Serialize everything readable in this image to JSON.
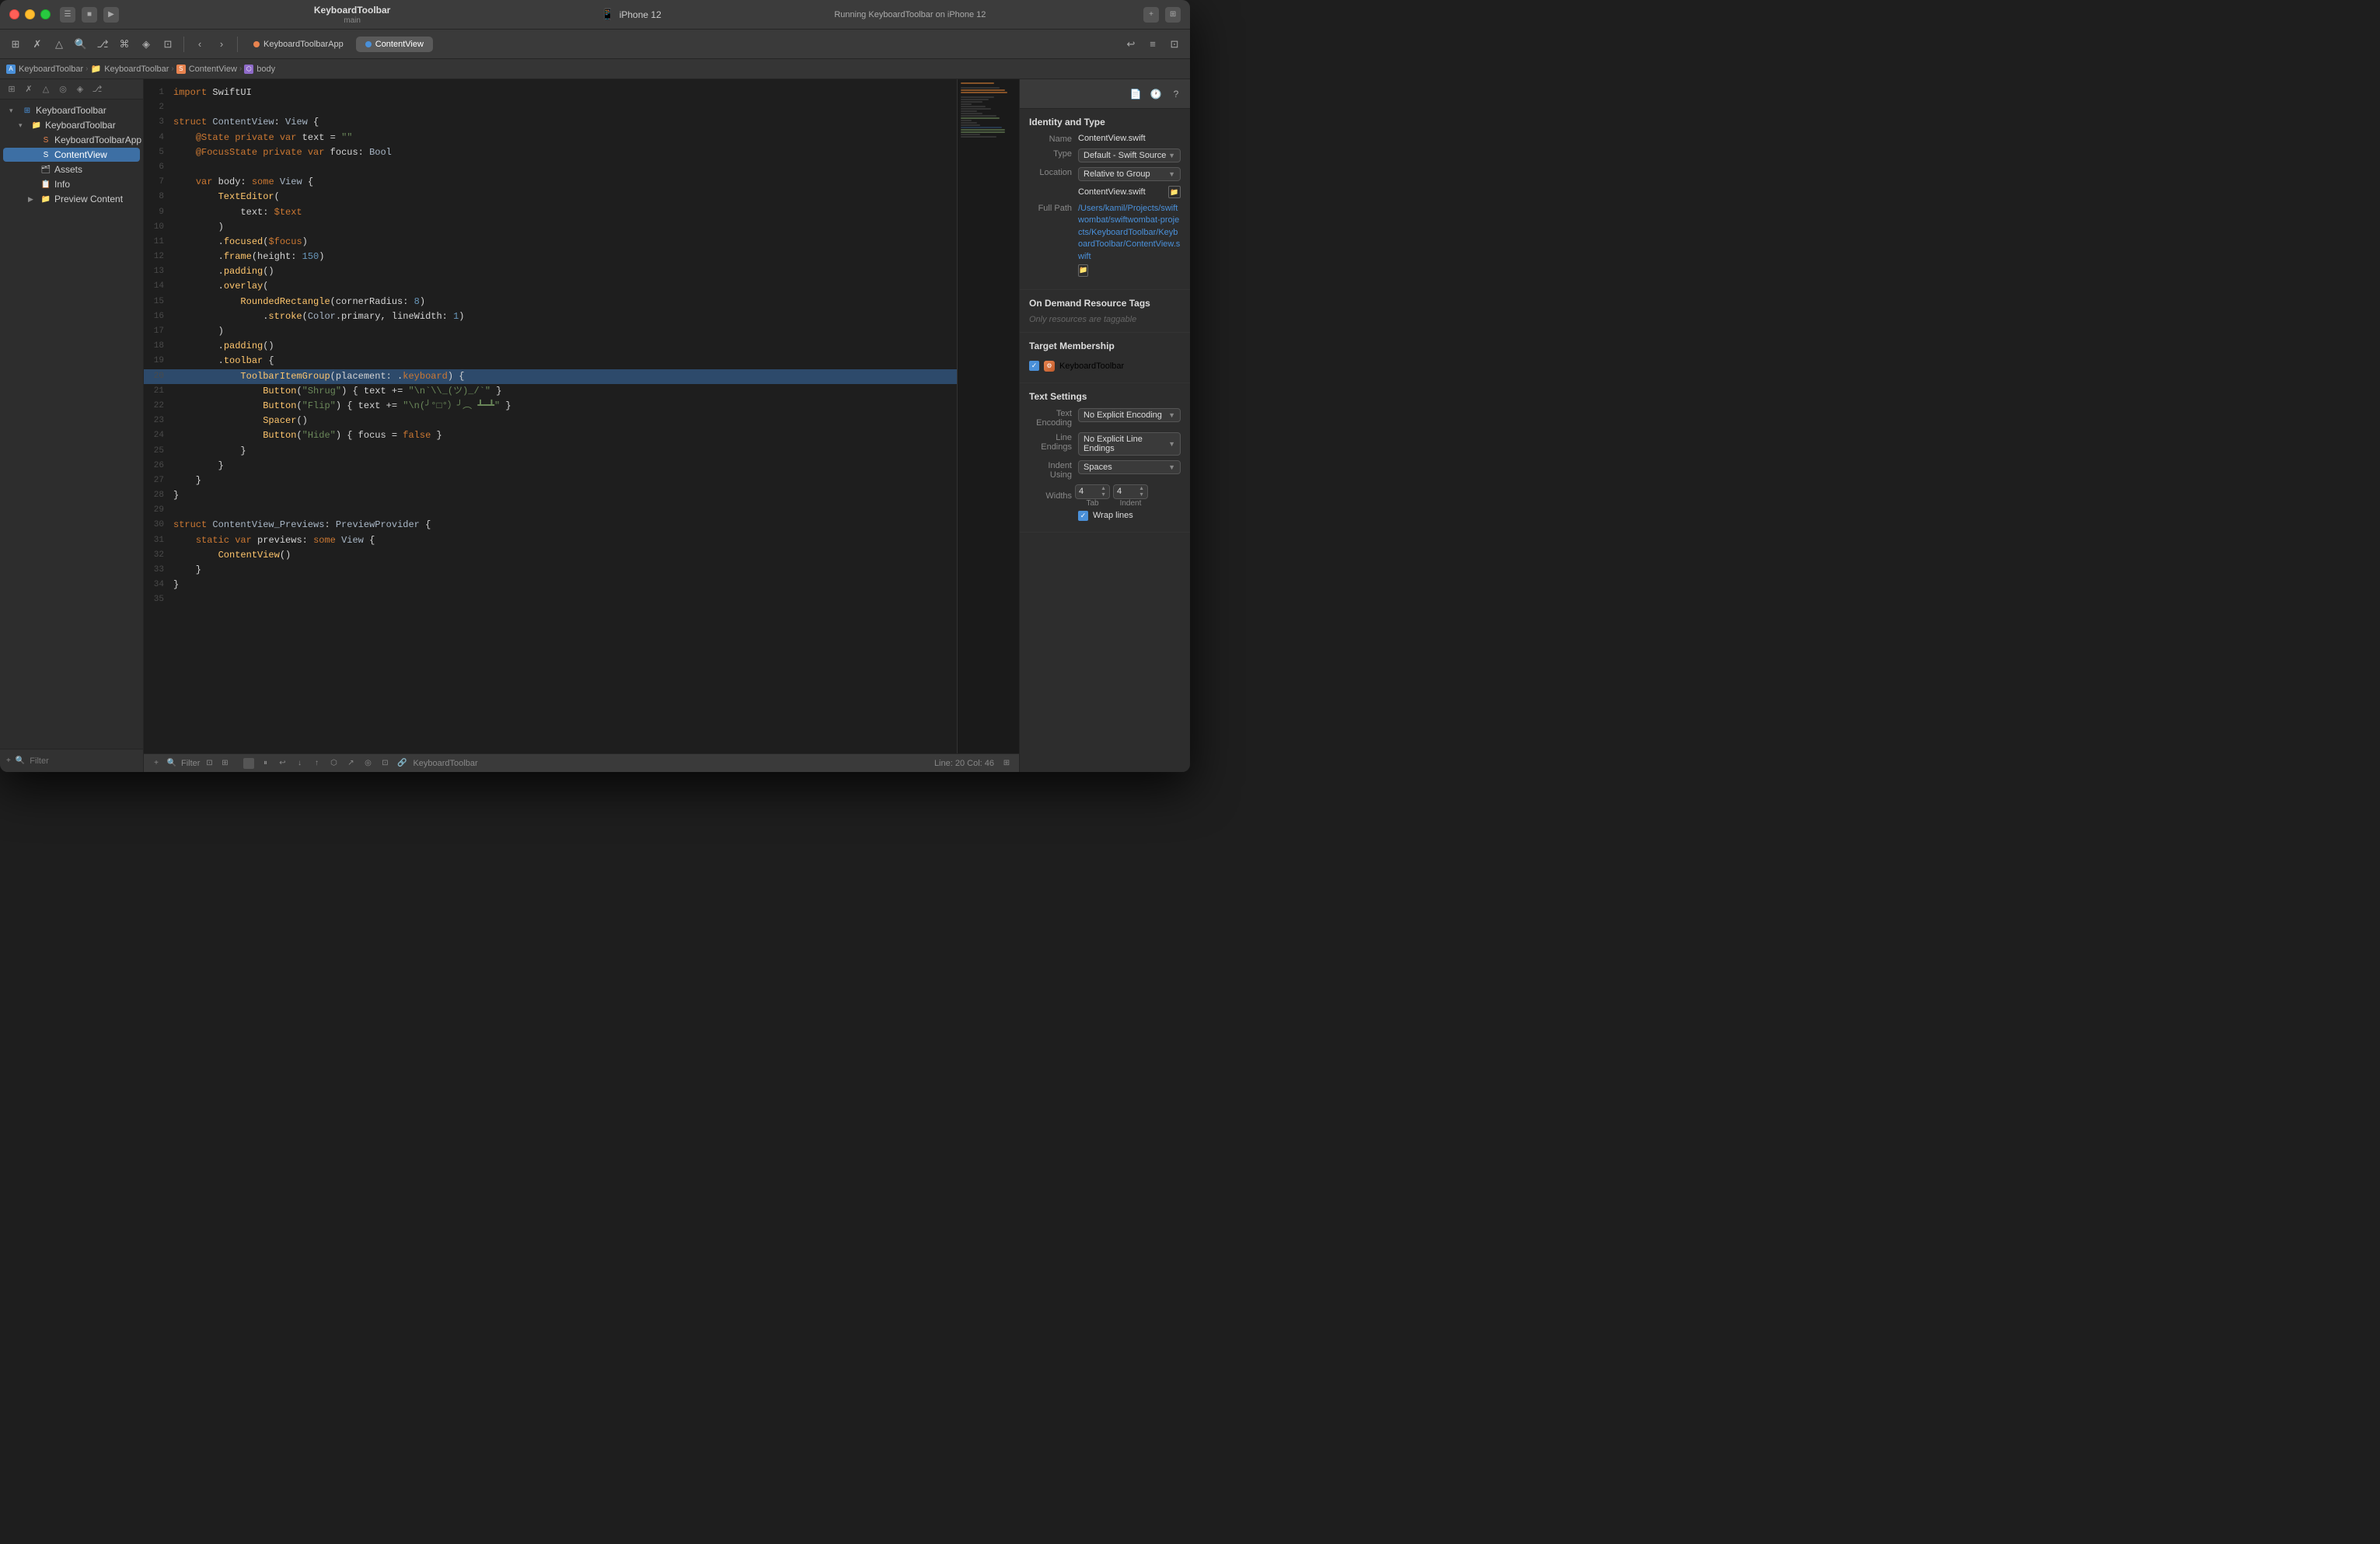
{
  "window": {
    "title": "KeyboardToolbar",
    "branch": "main",
    "device": "iPhone 12",
    "status": "Running KeyboardToolbar on iPhone 12"
  },
  "toolbar": {
    "tabs": [
      {
        "id": "app",
        "label": "KeyboardToolbarApp",
        "type": "swift",
        "active": false
      },
      {
        "id": "content",
        "label": "ContentView",
        "type": "swift",
        "active": true
      }
    ]
  },
  "breadcrumb": {
    "items": [
      {
        "label": "KeyboardToolbar",
        "icon": "A",
        "iconType": "blue"
      },
      {
        "label": "KeyboardToolbar",
        "icon": "📁",
        "iconType": "folder"
      },
      {
        "label": "ContentView",
        "icon": "S",
        "iconType": "orange"
      },
      {
        "label": "body",
        "icon": "⬡",
        "iconType": "purple"
      }
    ]
  },
  "sidebar": {
    "items": [
      {
        "label": "KeyboardToolbar",
        "level": 0,
        "expanded": true,
        "type": "project"
      },
      {
        "label": "KeyboardToolbar",
        "level": 1,
        "expanded": true,
        "type": "folder"
      },
      {
        "label": "KeyboardToolbarApp",
        "level": 2,
        "expanded": false,
        "type": "swift"
      },
      {
        "label": "ContentView",
        "level": 2,
        "expanded": false,
        "type": "swift",
        "selected": true
      },
      {
        "label": "Assets",
        "level": 2,
        "expanded": false,
        "type": "assets"
      },
      {
        "label": "Info",
        "level": 2,
        "expanded": false,
        "type": "info"
      },
      {
        "label": "Preview Content",
        "level": 2,
        "expanded": false,
        "type": "folder"
      }
    ],
    "filter_placeholder": "Filter"
  },
  "code": {
    "lines": [
      {
        "num": 1,
        "content": "import SwiftUI"
      },
      {
        "num": 2,
        "content": ""
      },
      {
        "num": 3,
        "content": "struct ContentView: View {"
      },
      {
        "num": 4,
        "content": "    @State private var text = \"\""
      },
      {
        "num": 5,
        "content": "    @FocusState private var focus: Bool"
      },
      {
        "num": 6,
        "content": ""
      },
      {
        "num": 7,
        "content": "    var body: some View {"
      },
      {
        "num": 8,
        "content": "        TextEditor("
      },
      {
        "num": 9,
        "content": "            text: $text"
      },
      {
        "num": 10,
        "content": "        )"
      },
      {
        "num": 11,
        "content": "        .focused($focus)"
      },
      {
        "num": 12,
        "content": "        .frame(height: 150)"
      },
      {
        "num": 13,
        "content": "        .padding()"
      },
      {
        "num": 14,
        "content": "        .overlay("
      },
      {
        "num": 15,
        "content": "            RoundedRectangle(cornerRadius: 8)"
      },
      {
        "num": 16,
        "content": "                .stroke(Color.primary, lineWidth: 1)"
      },
      {
        "num": 17,
        "content": "        )"
      },
      {
        "num": 18,
        "content": "        .padding()"
      },
      {
        "num": 19,
        "content": "        .toolbar {"
      },
      {
        "num": 20,
        "content": "            ToolbarItemGroup(placement: .keyboard) {",
        "highlighted": true
      },
      {
        "num": 21,
        "content": "                Button(\"Shrug\") { text += \"\\n`\\\\_(ツ)_/`\" }"
      },
      {
        "num": 22,
        "content": "                Button(\"Flip\") { text += \"\\n(╯°□°）╯︵ ┻━┻\" }"
      },
      {
        "num": 23,
        "content": "                Spacer()"
      },
      {
        "num": 24,
        "content": "                Button(\"Hide\") { focus = false }"
      },
      {
        "num": 25,
        "content": "            }"
      },
      {
        "num": 26,
        "content": "        }"
      },
      {
        "num": 27,
        "content": "    }"
      },
      {
        "num": 28,
        "content": "}"
      },
      {
        "num": 29,
        "content": ""
      },
      {
        "num": 30,
        "content": "struct ContentView_Previews: PreviewProvider {"
      },
      {
        "num": 31,
        "content": "    static var previews: some View {"
      },
      {
        "num": 32,
        "content": "        ContentView()"
      },
      {
        "num": 33,
        "content": "    }"
      },
      {
        "num": 34,
        "content": "}"
      },
      {
        "num": 35,
        "content": ""
      }
    ]
  },
  "status_bar": {
    "position": "Line: 20  Col: 46",
    "target": "KeyboardToolbar"
  },
  "inspector": {
    "title": "Identity and Type",
    "name_label": "Name",
    "name_value": "ContentView.swift",
    "type_label": "Type",
    "type_value": "Default - Swift Source",
    "location_label": "Location",
    "location_value": "Relative to Group",
    "filename_value": "ContentView.swift",
    "fullpath_label": "Full Path",
    "fullpath_value": "/Users/kamil/Projects/swiftwombat/swiftwombat-projects/KeyboardToolbar/KeyboardToolbar/ContentView.swift",
    "resource_tags": {
      "title": "On Demand Resource Tags",
      "placeholder": "Only resources are taggable"
    },
    "target_membership": {
      "title": "Target Membership",
      "target_name": "KeyboardToolbar"
    },
    "text_settings": {
      "title": "Text Settings",
      "encoding_label": "Text Encoding",
      "encoding_value": "No Explicit Encoding",
      "line_endings_label": "Line Endings",
      "line_endings_value": "No Explicit Line Endings",
      "indent_label": "Indent Using",
      "indent_value": "Spaces",
      "widths_label": "Widths",
      "tab_value": "4",
      "indent_value_num": "4",
      "tab_label": "Tab",
      "indent_label2": "Indent",
      "wrap_label": "Wrap lines"
    }
  }
}
